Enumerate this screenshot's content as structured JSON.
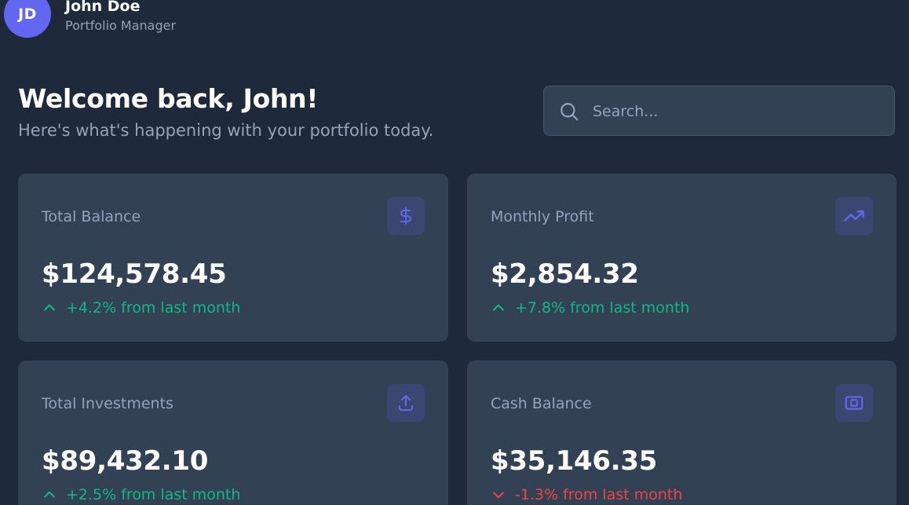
{
  "user": {
    "initials": "JD",
    "name": "John Doe",
    "role": "Portfolio Manager"
  },
  "welcome": {
    "title": "Welcome back, John!",
    "subtitle": "Here's what's happening with your portfolio today."
  },
  "search": {
    "placeholder": "Search...",
    "value": ""
  },
  "colors": {
    "background": "#1e293b",
    "card": "#334155",
    "accent": "#6366f1",
    "positive": "#10b981",
    "negative": "#ef4444",
    "muted": "#94a3b8"
  },
  "cards": [
    {
      "label": "Total Balance",
      "icon": "dollar-icon",
      "value": "$124,578.45",
      "change": "+4.2% from last month",
      "trend": "up"
    },
    {
      "label": "Monthly Profit",
      "icon": "trending-up-icon",
      "value": "$2,854.32",
      "change": "+7.8% from last month",
      "trend": "up"
    },
    {
      "label": "Total Investments",
      "icon": "upload-icon",
      "value": "$89,432.10",
      "change": "+2.5% from last month",
      "trend": "up"
    },
    {
      "label": "Cash Balance",
      "icon": "cash-icon",
      "value": "$35,146.35",
      "change": "-1.3% from last month",
      "trend": "down"
    }
  ]
}
